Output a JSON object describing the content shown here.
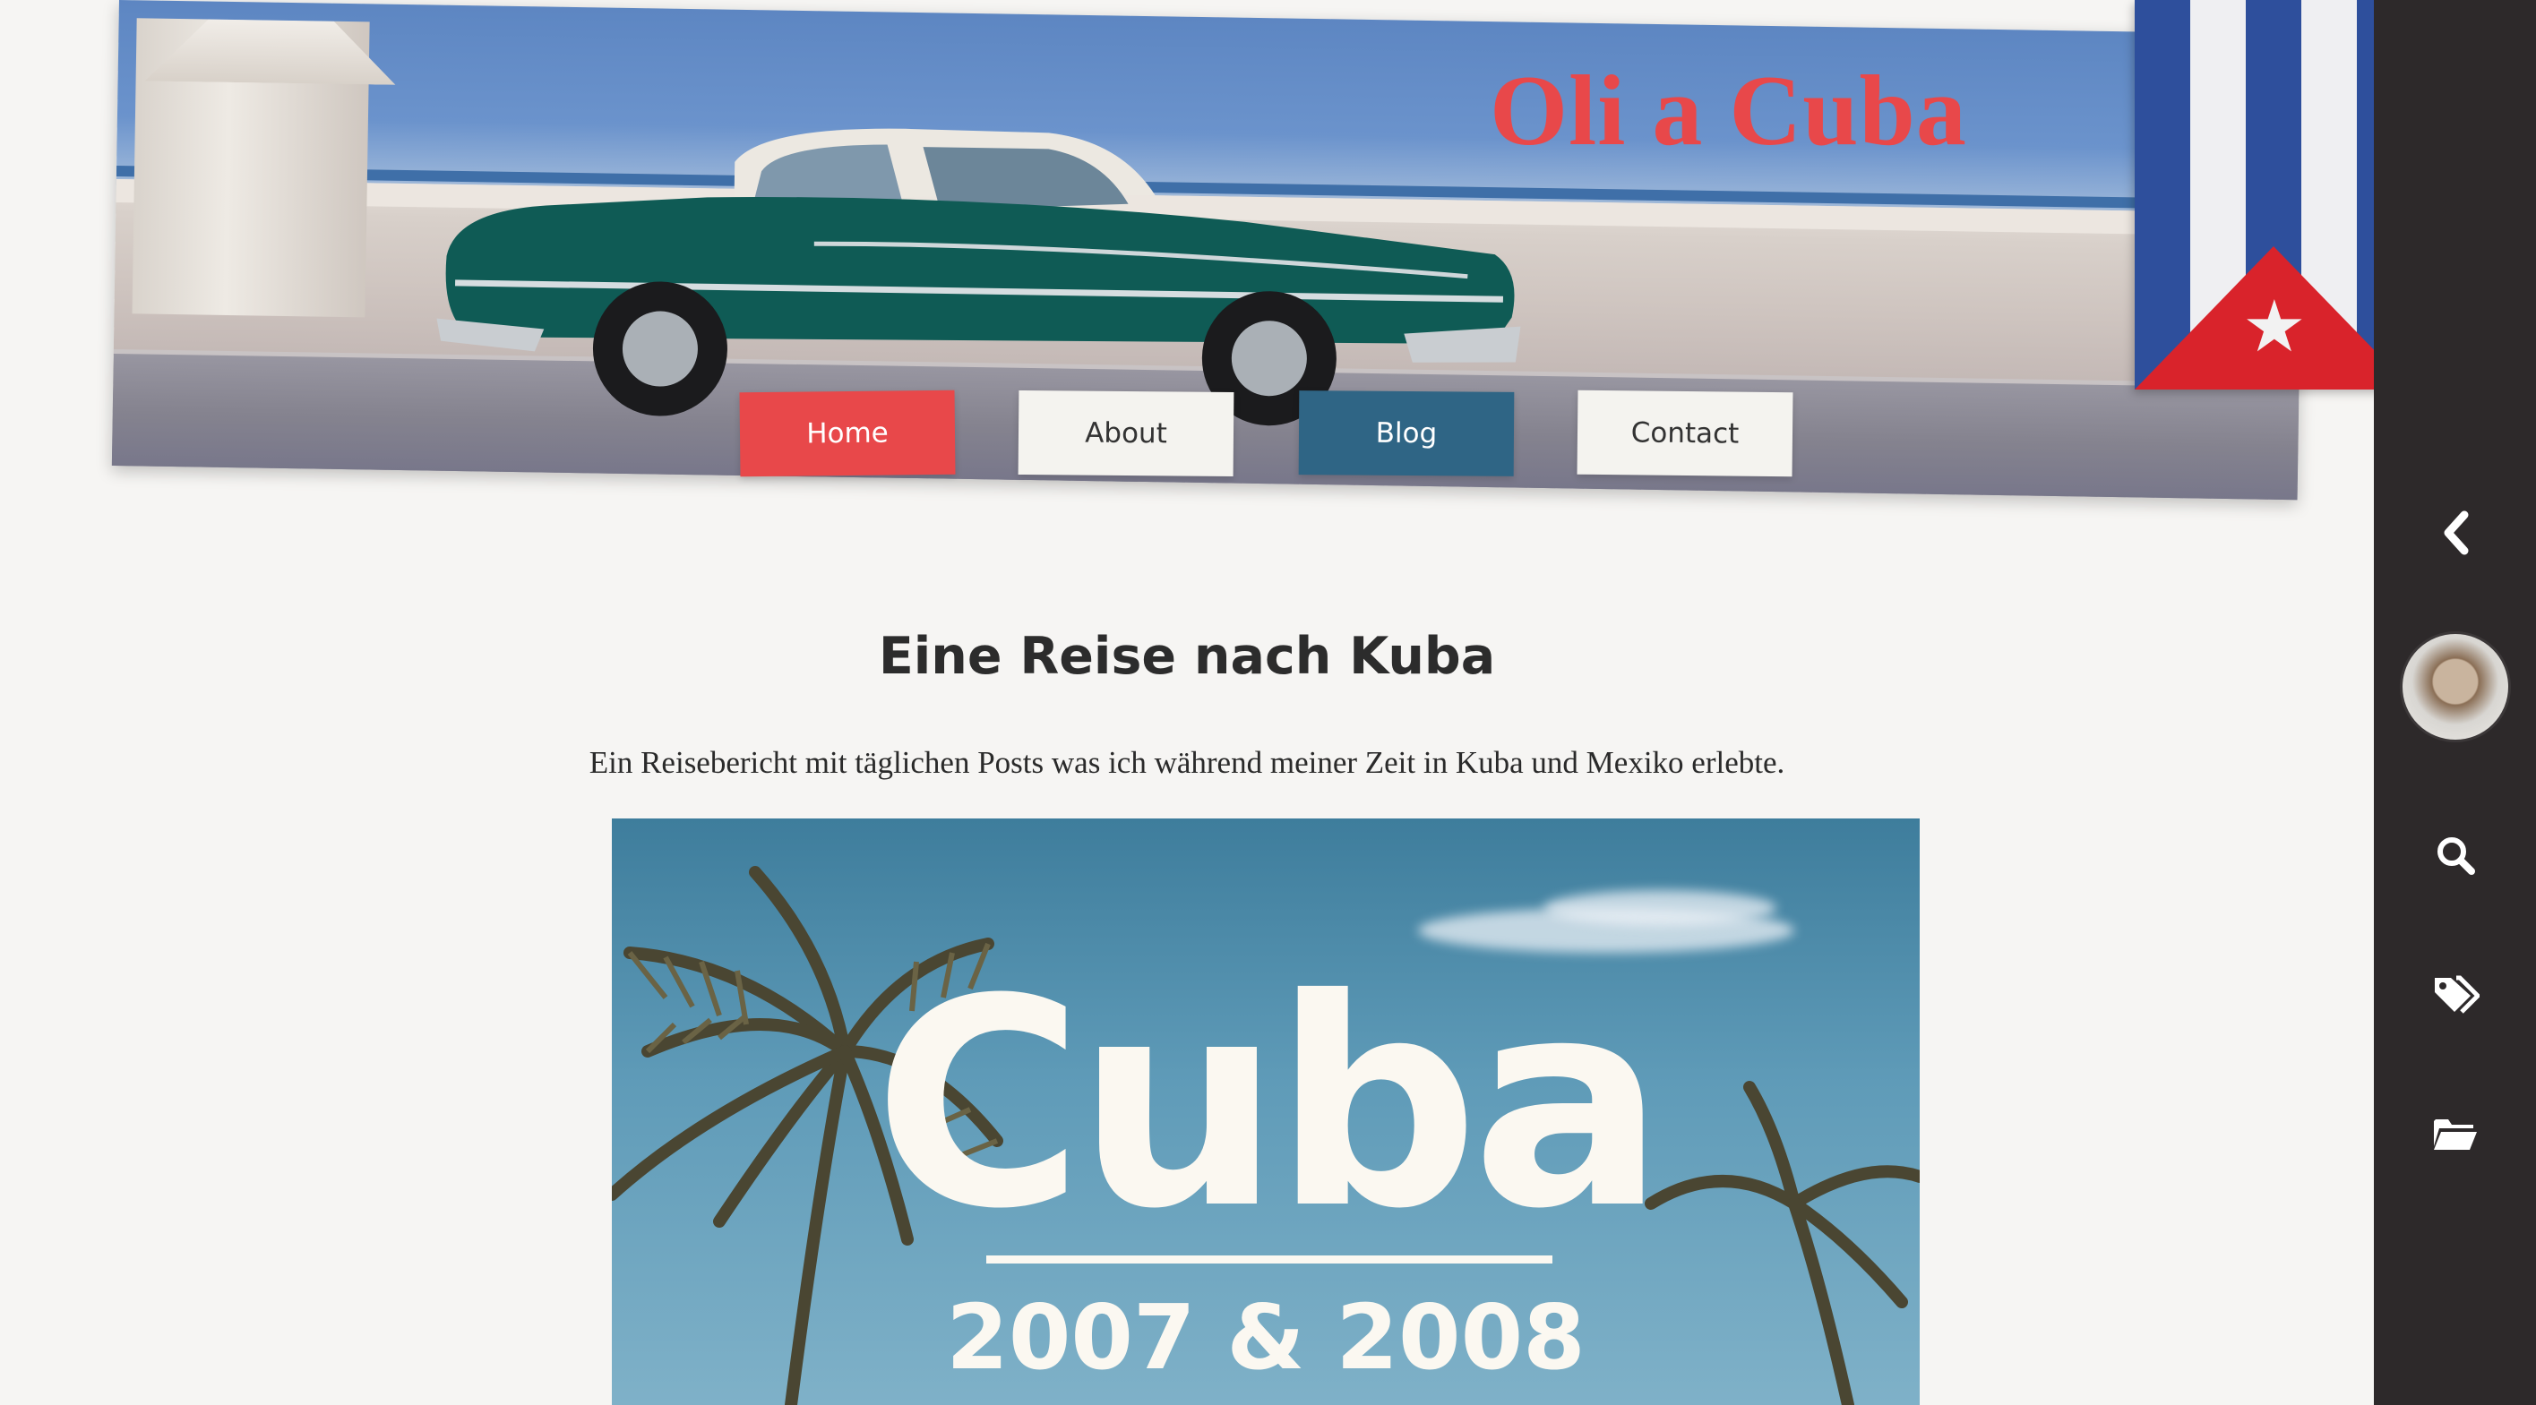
{
  "site": {
    "title": "Oli a Cuba"
  },
  "nav": {
    "home": "Home",
    "about": "About",
    "blog": "Blog",
    "contact": "Contact"
  },
  "post": {
    "title": "Eine Reise nach Kuba",
    "subtitle": "Ein Reisebericht mit täglichen Posts was ich während meiner Zeit in Kuba und Mexiko erlebte.",
    "hero": {
      "title": "Cuba",
      "years": "2007 & 2008"
    }
  },
  "sidebar": {
    "icons": [
      "chevron-left-icon",
      "avatar",
      "search-icon",
      "tags-icon",
      "folder-open-icon"
    ]
  },
  "colors": {
    "accent_red": "#e8484a",
    "accent_blue": "#2f6585",
    "sidebar_bg": "#2d292a",
    "page_bg": "#f6f5f3"
  }
}
